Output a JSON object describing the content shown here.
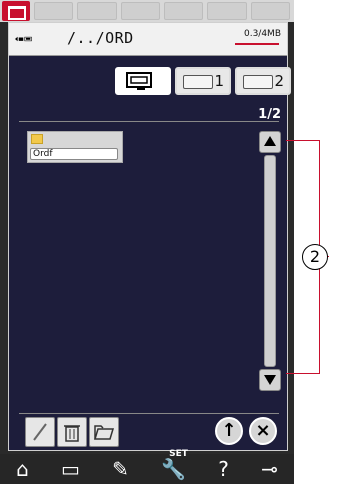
{
  "path": "/../ORD",
  "memory": "0.3/4MB",
  "source_buttons": [
    {
      "label": "",
      "selected": true
    },
    {
      "label": "1",
      "selected": false
    },
    {
      "label": "2",
      "selected": false
    }
  ],
  "page_indicator": "1/2",
  "folder": {
    "name": "Ordf"
  },
  "callout": {
    "number": "2"
  },
  "bottom": {
    "set_label": "SET",
    "help_symbol": "?"
  }
}
